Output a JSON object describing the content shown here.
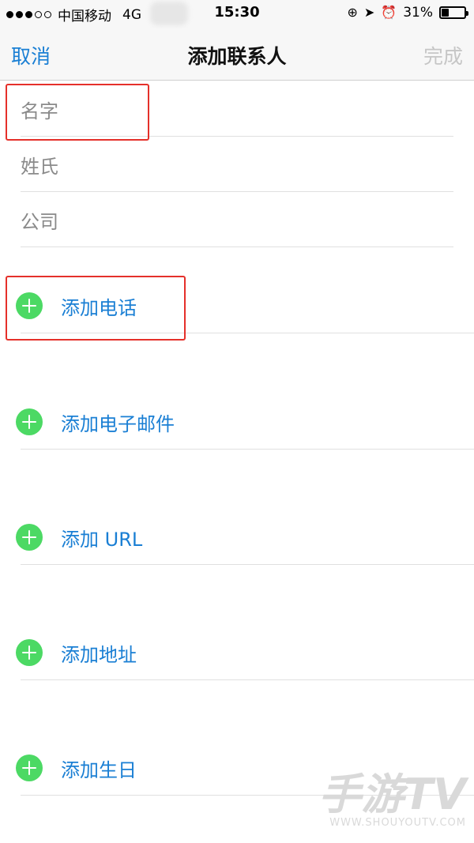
{
  "status_bar": {
    "carrier": "中国移动",
    "network": "4G",
    "time": "15:30",
    "battery_percent": "31%",
    "battery_level": 0.31,
    "icons": [
      "rotation-lock-icon",
      "location-arrow-icon",
      "alarm-icon"
    ]
  },
  "nav": {
    "cancel": "取消",
    "title": "添加联系人",
    "done": "完成"
  },
  "fields": {
    "first_name": "名字",
    "last_name": "姓氏",
    "company": "公司"
  },
  "add_rows": {
    "phone": "添加电话",
    "email": "添加电子邮件",
    "url": "添加 URL",
    "address": "添加地址",
    "birthday": "添加生日"
  },
  "colors": {
    "accent": "#1a7fd4",
    "add_icon": "#4cd964",
    "highlight": "#e5302a",
    "disabled": "#c6c6c6"
  },
  "watermark": {
    "main": "手游TV",
    "sub": "WWW.SHOUYOUTV.COM"
  }
}
